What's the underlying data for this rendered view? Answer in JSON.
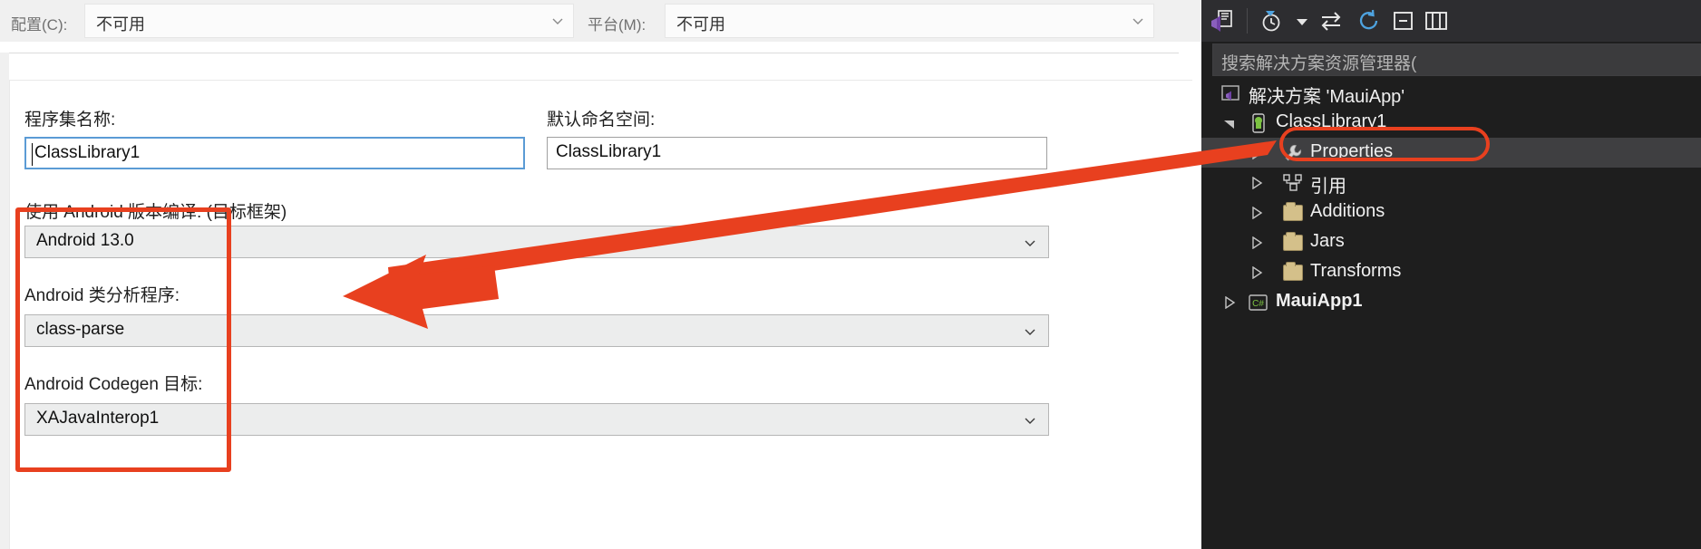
{
  "toolbar": {
    "config_label": "配置(C):",
    "config_value": "不可用",
    "platform_label": "平台(M):",
    "platform_value": "不可用",
    "chevron_icon": "chevron-down-icon"
  },
  "form": {
    "assembly_name_label": "程序集名称:",
    "assembly_name_value": "ClassLibrary1",
    "default_namespace_label": "默认命名空间:",
    "default_namespace_value": "ClassLibrary1",
    "target_framework_label": "使用 Android 版本编译: (目标框架)",
    "target_framework_value": "Android 13.0",
    "class_parser_label": "Android 类分析程序:",
    "class_parser_value": "class-parse",
    "codegen_label": "Android Codegen 目标:",
    "codegen_value": "XAJavaInterop1"
  },
  "solution_explorer": {
    "search_placeholder": "搜索解决方案资源管理器(",
    "toolbar_icons": [
      "vs-home-icon",
      "pending-changes-clock-icon",
      "dropdown-arrow-icon",
      "sync-with-active-document-icon",
      "refresh-icon",
      "collapse-all-icon",
      "show-all-files-icon"
    ],
    "tree": [
      {
        "label": "解决方案 'MauiApp'",
        "icon": "solution-icon",
        "indent": 22,
        "twisty": "",
        "selected": false,
        "bold": false
      },
      {
        "label": "ClassLibrary1",
        "icon": "android-project-icon",
        "indent": 52,
        "twisty": "expanded",
        "selected": false,
        "bold": false
      },
      {
        "label": "Properties",
        "icon": "wrench-icon",
        "indent": 82,
        "twisty": "collapsed",
        "selected": true,
        "bold": false
      },
      {
        "label": "引用",
        "icon": "references-icon",
        "indent": 82,
        "twisty": "collapsed",
        "selected": false,
        "bold": false
      },
      {
        "label": "Additions",
        "icon": "folder-icon",
        "indent": 82,
        "twisty": "collapsed",
        "selected": false,
        "bold": false
      },
      {
        "label": "Jars",
        "icon": "folder-icon",
        "indent": 82,
        "twisty": "collapsed",
        "selected": false,
        "bold": false
      },
      {
        "label": "Transforms",
        "icon": "folder-icon",
        "indent": 82,
        "twisty": "collapsed",
        "selected": false,
        "bold": false
      },
      {
        "label": "MauiApp1",
        "icon": "csharp-project-icon",
        "indent": 22,
        "twisty": "collapsed",
        "selected": false,
        "bold": true
      }
    ]
  },
  "annotations": {
    "accent_color": "#e8401f",
    "arrow_name": "red-arrow-annotation",
    "rect_name": "red-rectangle-annotation",
    "properties_highlight_name": "properties-highlight-annotation"
  }
}
